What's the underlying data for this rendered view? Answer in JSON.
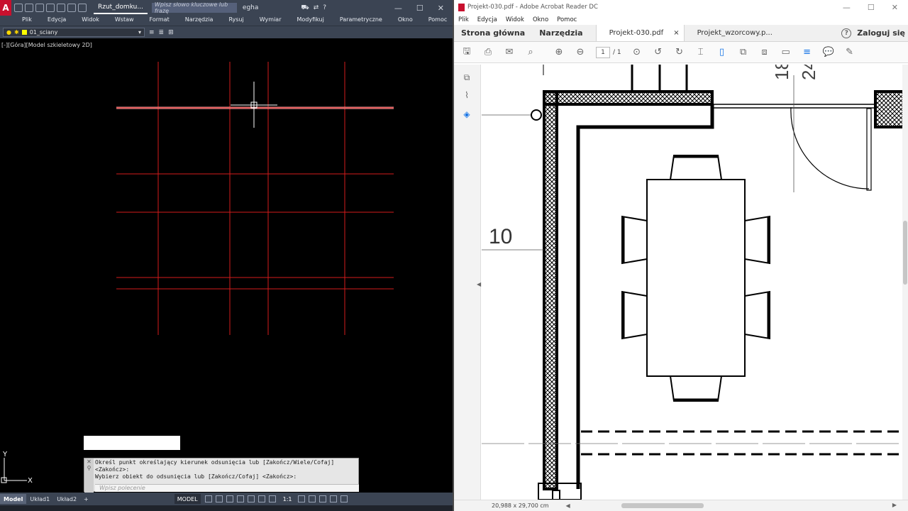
{
  "autocad": {
    "logo": "A",
    "doc_tab": "Rzut_domku...",
    "search_placeholder": "Wpisz słowo kluczowe lub frazę",
    "user": "egha",
    "menu": [
      "Plik",
      "Edycja",
      "Widok",
      "Wstaw",
      "Format",
      "Narzędzia",
      "Rysuj",
      "Wymiar",
      "Modyfikuj",
      "Parametryczne",
      "Okno",
      "Pomoc"
    ],
    "layer_name": "01_sciany",
    "viewport_label": "[-][Góra][Model szkieletowy 2D]",
    "axis_y": "Y",
    "axis_x": "X",
    "command_history": [
      "Określ punkt określający kierunek odsunięcia lub [Zakończ/Wiele/Cofaj]",
      "<Zakończ>:",
      "Wybierz obiekt do odsunięcia lub [Zakończ/Cofaj] <Zakończ>:"
    ],
    "command_placeholder": "Wpisz polecenie",
    "layout_tabs": [
      "Model",
      "Układ1",
      "Układ2"
    ],
    "add_tab": "+",
    "model_button": "MODEL",
    "scale": "1:1",
    "colors": {
      "background": "#000000",
      "lines": "#d41b1b",
      "ui": "#3b4453"
    }
  },
  "acrobat": {
    "title": "Projekt-030.pdf - Adobe Acrobat Reader DC",
    "menu": [
      "Plik",
      "Edycja",
      "Widok",
      "Okno",
      "Pomoc"
    ],
    "home_tab": "Strona główna",
    "tools_tab": "Narzędzia",
    "doc_tabs": [
      "Projekt-030.pdf",
      "Projekt_wzorcowy.p..."
    ],
    "close_tab": "×",
    "signin": "Zaloguj się",
    "help": "?",
    "page_current": "1",
    "page_total": "/ 1",
    "drawing_label_10": "10",
    "drawing_label_18": "18",
    "drawing_label_24": "24",
    "page_size": "20,988 x 29,700 cm",
    "colors": {
      "accent": "#1473e6"
    }
  }
}
